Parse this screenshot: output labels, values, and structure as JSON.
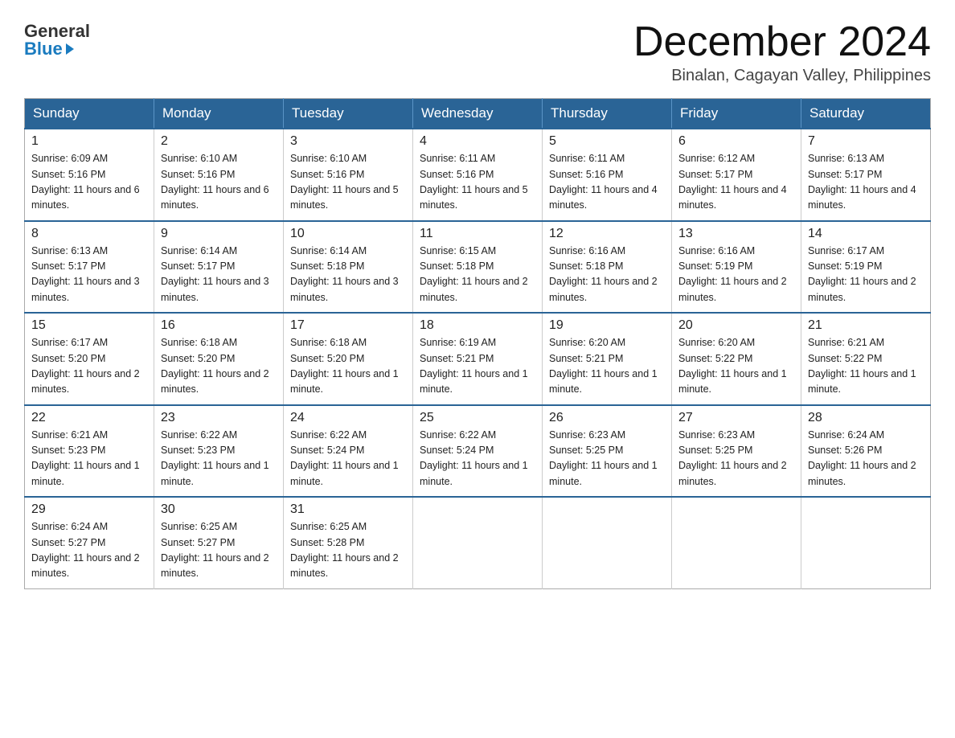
{
  "header": {
    "logo_general": "General",
    "logo_blue": "Blue",
    "month_title": "December 2024",
    "location": "Binalan, Cagayan Valley, Philippines"
  },
  "days_of_week": [
    "Sunday",
    "Monday",
    "Tuesday",
    "Wednesday",
    "Thursday",
    "Friday",
    "Saturday"
  ],
  "weeks": [
    [
      {
        "day": "1",
        "sunrise": "6:09 AM",
        "sunset": "5:16 PM",
        "daylight": "11 hours and 6 minutes."
      },
      {
        "day": "2",
        "sunrise": "6:10 AM",
        "sunset": "5:16 PM",
        "daylight": "11 hours and 6 minutes."
      },
      {
        "day": "3",
        "sunrise": "6:10 AM",
        "sunset": "5:16 PM",
        "daylight": "11 hours and 5 minutes."
      },
      {
        "day": "4",
        "sunrise": "6:11 AM",
        "sunset": "5:16 PM",
        "daylight": "11 hours and 5 minutes."
      },
      {
        "day": "5",
        "sunrise": "6:11 AM",
        "sunset": "5:16 PM",
        "daylight": "11 hours and 4 minutes."
      },
      {
        "day": "6",
        "sunrise": "6:12 AM",
        "sunset": "5:17 PM",
        "daylight": "11 hours and 4 minutes."
      },
      {
        "day": "7",
        "sunrise": "6:13 AM",
        "sunset": "5:17 PM",
        "daylight": "11 hours and 4 minutes."
      }
    ],
    [
      {
        "day": "8",
        "sunrise": "6:13 AM",
        "sunset": "5:17 PM",
        "daylight": "11 hours and 3 minutes."
      },
      {
        "day": "9",
        "sunrise": "6:14 AM",
        "sunset": "5:17 PM",
        "daylight": "11 hours and 3 minutes."
      },
      {
        "day": "10",
        "sunrise": "6:14 AM",
        "sunset": "5:18 PM",
        "daylight": "11 hours and 3 minutes."
      },
      {
        "day": "11",
        "sunrise": "6:15 AM",
        "sunset": "5:18 PM",
        "daylight": "11 hours and 2 minutes."
      },
      {
        "day": "12",
        "sunrise": "6:16 AM",
        "sunset": "5:18 PM",
        "daylight": "11 hours and 2 minutes."
      },
      {
        "day": "13",
        "sunrise": "6:16 AM",
        "sunset": "5:19 PM",
        "daylight": "11 hours and 2 minutes."
      },
      {
        "day": "14",
        "sunrise": "6:17 AM",
        "sunset": "5:19 PM",
        "daylight": "11 hours and 2 minutes."
      }
    ],
    [
      {
        "day": "15",
        "sunrise": "6:17 AM",
        "sunset": "5:20 PM",
        "daylight": "11 hours and 2 minutes."
      },
      {
        "day": "16",
        "sunrise": "6:18 AM",
        "sunset": "5:20 PM",
        "daylight": "11 hours and 2 minutes."
      },
      {
        "day": "17",
        "sunrise": "6:18 AM",
        "sunset": "5:20 PM",
        "daylight": "11 hours and 1 minute."
      },
      {
        "day": "18",
        "sunrise": "6:19 AM",
        "sunset": "5:21 PM",
        "daylight": "11 hours and 1 minute."
      },
      {
        "day": "19",
        "sunrise": "6:20 AM",
        "sunset": "5:21 PM",
        "daylight": "11 hours and 1 minute."
      },
      {
        "day": "20",
        "sunrise": "6:20 AM",
        "sunset": "5:22 PM",
        "daylight": "11 hours and 1 minute."
      },
      {
        "day": "21",
        "sunrise": "6:21 AM",
        "sunset": "5:22 PM",
        "daylight": "11 hours and 1 minute."
      }
    ],
    [
      {
        "day": "22",
        "sunrise": "6:21 AM",
        "sunset": "5:23 PM",
        "daylight": "11 hours and 1 minute."
      },
      {
        "day": "23",
        "sunrise": "6:22 AM",
        "sunset": "5:23 PM",
        "daylight": "11 hours and 1 minute."
      },
      {
        "day": "24",
        "sunrise": "6:22 AM",
        "sunset": "5:24 PM",
        "daylight": "11 hours and 1 minute."
      },
      {
        "day": "25",
        "sunrise": "6:22 AM",
        "sunset": "5:24 PM",
        "daylight": "11 hours and 1 minute."
      },
      {
        "day": "26",
        "sunrise": "6:23 AM",
        "sunset": "5:25 PM",
        "daylight": "11 hours and 1 minute."
      },
      {
        "day": "27",
        "sunrise": "6:23 AM",
        "sunset": "5:25 PM",
        "daylight": "11 hours and 2 minutes."
      },
      {
        "day": "28",
        "sunrise": "6:24 AM",
        "sunset": "5:26 PM",
        "daylight": "11 hours and 2 minutes."
      }
    ],
    [
      {
        "day": "29",
        "sunrise": "6:24 AM",
        "sunset": "5:27 PM",
        "daylight": "11 hours and 2 minutes."
      },
      {
        "day": "30",
        "sunrise": "6:25 AM",
        "sunset": "5:27 PM",
        "daylight": "11 hours and 2 minutes."
      },
      {
        "day": "31",
        "sunrise": "6:25 AM",
        "sunset": "5:28 PM",
        "daylight": "11 hours and 2 minutes."
      },
      null,
      null,
      null,
      null
    ]
  ]
}
